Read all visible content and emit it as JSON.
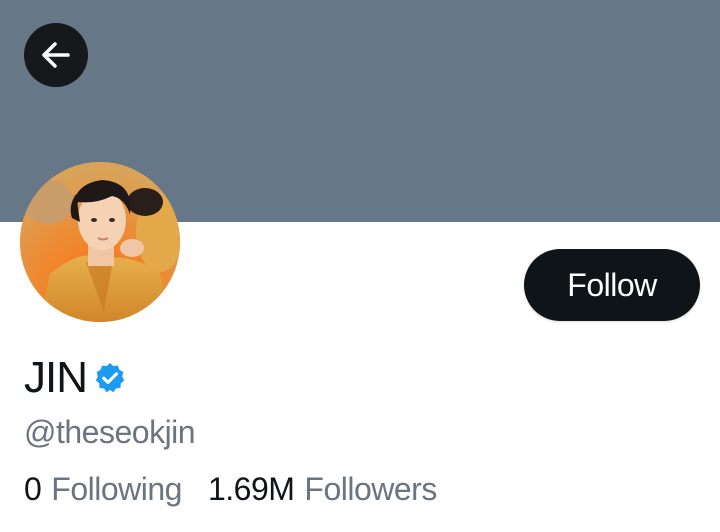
{
  "profile": {
    "display_name": "JIN",
    "handle": "@theseokjin",
    "verified": true,
    "banner_color": "#667788",
    "accent_color": "#1d9bf0"
  },
  "actions": {
    "back_icon": "arrow-left-icon",
    "follow_label": "Follow"
  },
  "stats": {
    "following_count": "0",
    "following_label": "Following",
    "followers_count": "1.69M",
    "followers_label": "Followers"
  }
}
